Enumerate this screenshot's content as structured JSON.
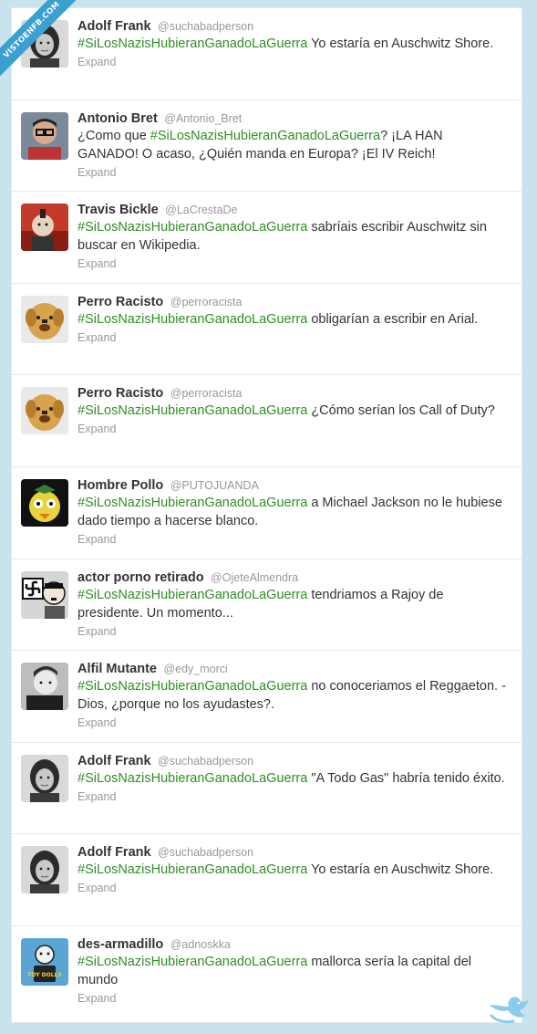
{
  "watermark": "VISTOENFB.COM",
  "expand_label": "Expand",
  "colors": {
    "hashtag": "#2f8f24",
    "name": "#333333",
    "muted": "#999999",
    "background": "#c9e3ee"
  },
  "tweets": [
    {
      "fullname": "Adolf Frank",
      "username": "@suchabadperson",
      "hashtag": "#SiLosNazisHubieranGanadoLaGuerra",
      "text_before": "",
      "text_after": " Yo estaría en Auschwitz Shore.",
      "avatar": "portrait-girl-avatar"
    },
    {
      "fullname": "Antonio Bret",
      "username": "@Antonio_Bret",
      "hashtag": "#SiLosNazisHubieranGanadoLaGuerra",
      "text_before": "¿Como que ",
      "text_after": "? ¡LA HAN GANADO! O acaso, ¿Quién manda en Europa? ¡El IV Reich!",
      "avatar": "man-glasses-avatar"
    },
    {
      "fullname": "Travis Bickle",
      "username": "@LaCrestaDe",
      "hashtag": "#SiLosNazisHubieranGanadoLaGuerra",
      "text_before": "",
      "text_after": " sabríais escribir Auschwitz sin buscar en Wikipedia.",
      "avatar": "mohawk-man-avatar"
    },
    {
      "fullname": "Perro Racisto",
      "username": "@perroracista",
      "hashtag": "#SiLosNazisHubieranGanadoLaGuerra",
      "text_before": "",
      "text_after": " obligarían a escribir en Arial.",
      "avatar": "dog-avatar"
    },
    {
      "fullname": "Perro Racisto",
      "username": "@perroracista",
      "hashtag": "#SiLosNazisHubieranGanadoLaGuerra",
      "text_before": "",
      "text_after": " ¿Cómo serían los Call of Duty?",
      "avatar": "dog-avatar"
    },
    {
      "fullname": "Hombre Pollo",
      "username": "@PUTOJUANDA",
      "hashtag": "#SiLosNazisHubieranGanadoLaGuerra",
      "text_before": "",
      "text_after": " a Michael Jackson no le hubiese dado tiempo a hacerse blanco.",
      "avatar": "chicken-man-avatar"
    },
    {
      "fullname": "actor porno retirado",
      "username": "@OjeteAlmendra",
      "hashtag": "#SiLosNazisHubieranGanadoLaGuerra",
      "text_before": "",
      "text_after": " tendriamos a Rajoy de presidente. Un momento...",
      "avatar": "cartoon-dictator-avatar"
    },
    {
      "fullname": "Alfil Mutante",
      "username": "@edy_morci",
      "hashtag": "#SiLosNazisHubieranGanadoLaGuerra",
      "text_before": "",
      "text_after": " no conoceriamos el Reggaeton. -Dios, ¿porque no los ayudastes?.",
      "avatar": "bw-man-avatar"
    },
    {
      "fullname": "Adolf Frank",
      "username": "@suchabadperson",
      "hashtag": "#SiLosNazisHubieranGanadoLaGuerra",
      "text_before": "",
      "text_after": " \"A Todo Gas\" habría tenido éxito.",
      "avatar": "portrait-girl-avatar"
    },
    {
      "fullname": "Adolf Frank",
      "username": "@suchabadperson",
      "hashtag": "#SiLosNazisHubieranGanadoLaGuerra",
      "text_before": "",
      "text_after": " Yo estaría en Auschwitz Shore.",
      "avatar": "portrait-girl-avatar"
    },
    {
      "fullname": "des-armadillo",
      "username": "@adnoskka",
      "hashtag": "#SiLosNazisHubieranGanadoLaGuerra",
      "text_before": "",
      "text_after": " mallorca sería la capital del mundo",
      "avatar": "toy-dolls-avatar"
    }
  ],
  "avatar_badge_text": "TOY DOLLS"
}
